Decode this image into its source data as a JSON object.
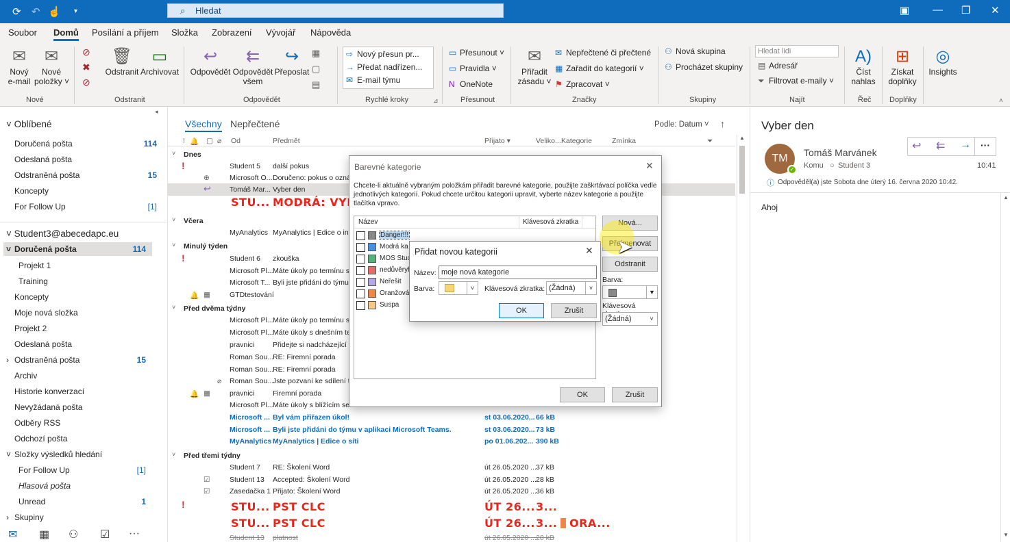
{
  "titlebar": {
    "search_placeholder": "Hledat"
  },
  "menu": [
    "Soubor",
    "Domů",
    "Posílání a příjem",
    "Složka",
    "Zobrazení",
    "Vývojář",
    "Nápověda"
  ],
  "ribbon": {
    "new_email": [
      "Nový",
      "e-mail"
    ],
    "new_items": [
      "Nové",
      "položky ˅"
    ],
    "delete": "Odstranit",
    "archive": "Archivovat",
    "reply": "Odpovědět",
    "reply_all": [
      "Odpovědět",
      "všem"
    ],
    "forward": "Přeposlat",
    "quick_steps": [
      "Nový přesun pr...",
      "Předat nadřízen...",
      "E-mail týmu"
    ],
    "move_items": [
      "Přesunout ˅",
      "Pravidla ˅",
      "OneNote"
    ],
    "assign_policy": [
      "Přiřadit",
      "zásadu ˅"
    ],
    "tags": [
      "Nepřečtené či přečtené",
      "Zařadit do kategorií ˅",
      "Zpracovat ˅"
    ],
    "groups_items": [
      "Nová skupina",
      "Procházet skupiny"
    ],
    "find_placeholder": "Hledat lidi",
    "find_items": [
      "Adresář",
      "Filtrovat e-maily ˅"
    ],
    "read_aloud": [
      "Číst",
      "nahlas"
    ],
    "addins": [
      "Získat",
      "doplňky"
    ],
    "insights": "Insights",
    "group_labels": [
      "Nové",
      "Odstranit",
      "Odpovědět",
      "Rychlé kroky",
      "Přesunout",
      "Značky",
      "Skupiny",
      "Najít",
      "Řeč",
      "Doplňky"
    ]
  },
  "folders": {
    "favorites_title": "Oblíbené",
    "favorites": [
      {
        "label": "Doručená pošta",
        "count": "114"
      },
      {
        "label": "Odeslaná pošta",
        "count": ""
      },
      {
        "label": "Odstraněná pošta",
        "count": "15"
      },
      {
        "label": "Koncepty",
        "count": ""
      },
      {
        "label": "For Follow Up",
        "count": "[1]"
      }
    ],
    "account": "Student3@abecedapc.eu",
    "inbox": {
      "label": "Doručená pošta",
      "count": "114"
    },
    "items": [
      {
        "label": "Projekt 1",
        "count": ""
      },
      {
        "label": "Training",
        "count": ""
      },
      {
        "label": "Koncepty",
        "count": ""
      },
      {
        "label": "Moje nová složka",
        "count": ""
      },
      {
        "label": "Projekt 2",
        "count": ""
      },
      {
        "label": "Odeslaná pošta",
        "count": ""
      },
      {
        "label": "Odstraněná pošta",
        "count": "15"
      },
      {
        "label": "Archiv",
        "count": ""
      },
      {
        "label": "Historie konverzací",
        "count": ""
      },
      {
        "label": "Nevyžádaná pošta",
        "count": ""
      },
      {
        "label": "Odběry RSS",
        "count": ""
      },
      {
        "label": "Odchozí pošta",
        "count": ""
      },
      {
        "label": "Složky výsledků hledání",
        "count": ""
      },
      {
        "label": "For Follow Up",
        "count": "[1]"
      },
      {
        "label": "Hlasová pošta",
        "count": ""
      },
      {
        "label": "Unread",
        "count": "1"
      },
      {
        "label": "Skupiny",
        "count": ""
      }
    ]
  },
  "list": {
    "tab_all": "Všechny",
    "tab_unread": "Nepřečtené",
    "sort": "Podle: Datum ˅",
    "sort_dir": "↑",
    "cols": {
      "from": "Od",
      "subject": "Předmět",
      "received": "Přijato ▾",
      "size": "Veliko...",
      "category": "Kategorie",
      "mention": "Zmínka"
    },
    "groups": [
      "Dnes",
      "Včera",
      "Minulý týden",
      "Před dvěma týdny",
      "Před třemi týdny"
    ],
    "rows": [
      {
        "from": "Student 5",
        "subject": "další pokus",
        "date": "",
        "size": "",
        "important": true
      },
      {
        "from": "Microsoft O...",
        "subject": "Doručeno: pokus o ozná",
        "date": "",
        "size": ""
      },
      {
        "from": "Tomáš Mar...",
        "subject": "Vyber den",
        "date": "",
        "size": ""
      },
      {
        "from": "STU...",
        "subject": "MODRÁ: VYB",
        "date": "",
        "size": ""
      },
      {
        "from": "MyAnalytics",
        "subject": "MyAnalytics | Edice o inte",
        "date": "",
        "size": ""
      },
      {
        "from": "Student 6",
        "subject": "zkouška",
        "date": "",
        "size": "",
        "important": true
      },
      {
        "from": "Microsoft Pl...",
        "subject": "Máte úkoly po termínu sp",
        "date": "",
        "size": ""
      },
      {
        "from": "Microsoft T...",
        "subject": "Byli jste přidáni do týmu",
        "date": "",
        "size": ""
      },
      {
        "from": "GTDtestování",
        "subject": "",
        "date": "",
        "size": ""
      },
      {
        "from": "Microsoft Pl...",
        "subject": "Máte úkoly po termínu sp",
        "date": "",
        "size": ""
      },
      {
        "from": "Microsoft Pl...",
        "subject": "Máte úkoly s dnešním ter",
        "date": "",
        "size": ""
      },
      {
        "from": "pravnici",
        "subject": "Přidejte si nadcházející u",
        "date": "",
        "size": ""
      },
      {
        "from": "Roman Sou...",
        "subject": "RE: Firemní porada",
        "date": "",
        "size": ""
      },
      {
        "from": "Roman Sou...",
        "subject": "RE: Firemní porada",
        "date": "",
        "size": ""
      },
      {
        "from": "Roman Sou...",
        "subject": "Jste pozvaní ke sdílení to",
        "date": "",
        "size": ""
      },
      {
        "from": "pravnici",
        "subject": "Firemní porada",
        "date": "",
        "size": ""
      },
      {
        "from": "Microsoft Pl...",
        "subject": "Máte úkoly s blížícím se t",
        "date": "",
        "size": ""
      },
      {
        "from": "Microsoft ...",
        "subject": "Byl vám přiřazen úkol!",
        "date": "st 03.06.2020...",
        "size": "66 kB"
      },
      {
        "from": "Microsoft ...",
        "subject": "Byli jste přidáni do týmu v aplikaci Microsoft Teams.",
        "date": "st 03.06.2020...",
        "size": "73 kB"
      },
      {
        "from": "MyAnalytics",
        "subject": "MyAnalytics | Edice o síti",
        "date": "po 01.06.202...",
        "size": "390 kB"
      },
      {
        "from": "Student 7",
        "subject": "RE: Školení Word",
        "date": "út 26.05.2020 ...",
        "size": "37 kB"
      },
      {
        "from": "Student 13",
        "subject": "Accepted: Školení Word",
        "date": "út 26.05.2020 ...",
        "size": "28 kB"
      },
      {
        "from": "Zasedačka 1",
        "subject": "Přijato: Školení Word",
        "date": "út 26.05.2020 ...",
        "size": "36 kB"
      },
      {
        "from": "STU...",
        "subject": "PST CLC",
        "date": "ÚT 26...",
        "size": "3..."
      },
      {
        "from": "STU...",
        "subject": "PST CLC",
        "date": "ÚT 26...",
        "size": "3...",
        "category": "ORA..."
      },
      {
        "from": "Student 13",
        "subject": "platnost",
        "date": "út 26.05.2020 ...",
        "size": "28 kB"
      }
    ]
  },
  "reading": {
    "subject": "Vyber den",
    "initials": "TM",
    "sender": "Tomáš Marvánek",
    "to_label": "Komu",
    "to": "Student 3",
    "time": "10:41",
    "info": "Odpověděl(a) jste Sobota dne úterý 16. června 2020 10:42.",
    "body": "Ahoj",
    "more": "···"
  },
  "dialog_categories": {
    "title": "Barevné kategorie",
    "description": "Chcete-li aktuálně vybraným položkám přiřadit barevné kategorie, použijte zaškrtávací políčka vedle jednotlivých kategorií. Pokud chcete určitou kategorii upravit, vyberte název kategorie a použijte tlačítka vpravo.",
    "col_name": "Název",
    "col_shortcut": "Klávesová zkratka",
    "categories": [
      {
        "name": "Danger!!!",
        "color": "#8a8886"
      },
      {
        "name": "Modrá ka",
        "color": "#4a90e2"
      },
      {
        "name": "MOS Stud",
        "color": "#4fb37a"
      },
      {
        "name": "nedůvěryh",
        "color": "#e86b6b"
      },
      {
        "name": "Neřešit",
        "color": "#b7a8e8"
      },
      {
        "name": "Oranžová",
        "color": "#f0874a"
      },
      {
        "name": "Suspa",
        "color": "#f5c98a"
      }
    ],
    "btn_new": "Nová...",
    "btn_rename": "Přejmenovat",
    "btn_delete": "Odstranit",
    "color_label": "Barva:",
    "shortcut_label": "Klávesová zkratka:",
    "shortcut_value": "(Žádná)",
    "ok": "OK",
    "cancel": "Zrušit"
  },
  "dialog_new": {
    "title": "Přidat novou kategorii",
    "name_label": "Název:",
    "name_value": "moje nová kategorie",
    "color_label": "Barva:",
    "color": "#f7d774",
    "shortcut_label": "Klávesová zkratka:",
    "shortcut_value": "(Žádná)",
    "ok": "OK",
    "cancel": "Zrušit"
  }
}
